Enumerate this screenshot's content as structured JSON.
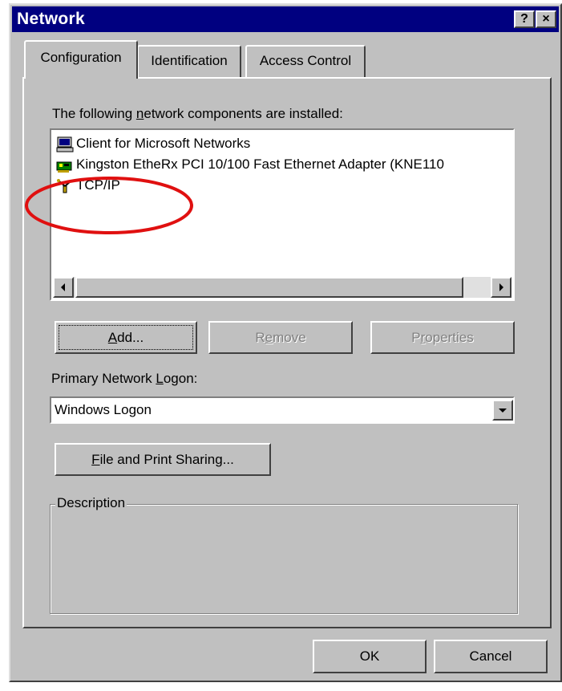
{
  "window": {
    "title": "Network",
    "help_button": "?",
    "close_button": "×"
  },
  "tabs": [
    {
      "label": "Configuration",
      "active": true
    },
    {
      "label": "Identification",
      "active": false
    },
    {
      "label": "Access Control",
      "active": false
    }
  ],
  "components": {
    "label_pre": "The following ",
    "label_u": "n",
    "label_post": "etwork components are installed:",
    "items": [
      {
        "label": "Client for Microsoft Networks",
        "icon": "computer-icon"
      },
      {
        "label": "Kingston EtheRx PCI 10/100 Fast Ethernet Adapter (KNE110",
        "icon": "network-adapter-icon"
      },
      {
        "label": "TCP/IP",
        "icon": "protocol-icon"
      }
    ]
  },
  "buttons": {
    "add": {
      "u": "A",
      "rest": "dd..."
    },
    "remove": {
      "pre": "R",
      "u": "e",
      "rest": "move"
    },
    "properties": {
      "pre": "P",
      "u": "r",
      "rest": "operties"
    }
  },
  "logon": {
    "label_pre": "Primary Network ",
    "label_u": "L",
    "label_post": "ogon:",
    "value": "Windows Logon"
  },
  "file_print": {
    "u": "F",
    "rest": "ile and Print Sharing..."
  },
  "description": {
    "label": "Description"
  },
  "ok_label": "OK",
  "cancel_label": "Cancel",
  "annotation_color": "#e01010"
}
